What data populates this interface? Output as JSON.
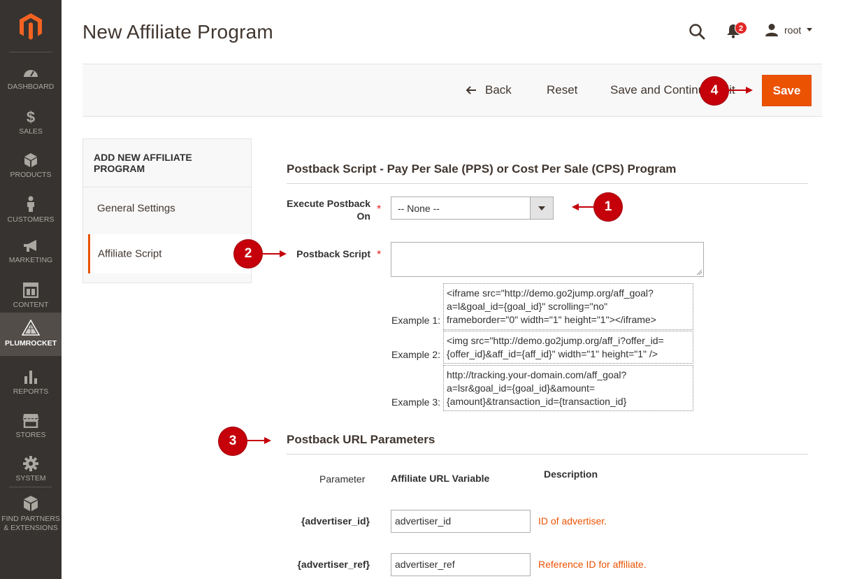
{
  "sidebar": {
    "items": [
      {
        "label": "DASHBOARD",
        "icon": "dashboard-icon"
      },
      {
        "label": "SALES",
        "icon": "dollar-icon"
      },
      {
        "label": "PRODUCTS",
        "icon": "box-icon"
      },
      {
        "label": "CUSTOMERS",
        "icon": "person-icon"
      },
      {
        "label": "MARKETING",
        "icon": "megaphone-icon"
      },
      {
        "label": "CONTENT",
        "icon": "layout-icon"
      },
      {
        "label": "PLUMROCKET",
        "icon": "plumrocket-icon"
      },
      {
        "label": "REPORTS",
        "icon": "bar-chart-icon"
      },
      {
        "label": "STORES",
        "icon": "store-icon"
      },
      {
        "label": "SYSTEM",
        "icon": "gear-icon"
      },
      {
        "label": "FIND PARTNERS & EXTENSIONS",
        "icon": "cube-icon"
      }
    ],
    "active": "PLUMROCKET"
  },
  "header": {
    "title": "New Affiliate Program",
    "notifications_count": "2",
    "user": "root"
  },
  "actions": {
    "back": "Back",
    "reset": "Reset",
    "save_continue": "Save and Continue Edit",
    "save": "Save"
  },
  "tabs": {
    "title": "ADD NEW AFFILIATE PROGRAM",
    "items": [
      "General Settings",
      "Affiliate Script"
    ],
    "active": "Affiliate Script"
  },
  "form": {
    "section1_title": "Postback Script - Pay Per Sale (PPS) or Cost Per Sale (CPS) Program",
    "execute_label_line1": "Execute Postback",
    "execute_label_line2": "On",
    "execute_value": "-- None --",
    "script_label": "Postback Script",
    "script_value": "",
    "examples": [
      {
        "label": "Example 1:",
        "lines": [
          "<iframe src=\"http://demo.go2jump.org/aff_goal?",
          "a=l&goal_id={goal_id}\" scrolling=\"no\"",
          "frameborder=\"0\" width=\"1\" height=\"1\"></iframe>"
        ]
      },
      {
        "label": "Example 2:",
        "lines": [
          "<img src=\"http://demo.go2jump.org/aff_i?offer_id=",
          "{offer_id}&aff_id={aff_id}\" width=\"1\" height=\"1\" />"
        ]
      },
      {
        "label": "Example 3:",
        "lines": [
          "http://tracking.your-domain.com/aff_goal?",
          "a=lsr&goal_id={goal_id}&amount=",
          "{amount}&transaction_id={transaction_id}"
        ]
      }
    ],
    "section2_title": "Postback URL Parameters",
    "columns": {
      "parameter": "Parameter",
      "variable": "Affiliate URL Variable",
      "description": "Description"
    },
    "params": [
      {
        "name": "{advertiser_id}",
        "value": "advertiser_id",
        "description": "ID of advertiser."
      },
      {
        "name": "{advertiser_ref}",
        "value": "advertiser_ref",
        "description": "Reference ID for affiliate."
      }
    ]
  },
  "callouts": [
    "1",
    "2",
    "3",
    "4"
  ],
  "colors": {
    "sidebar_bg": "#373330",
    "accent": "#eb5202",
    "callout": "#c5000b",
    "required": "#e22626"
  }
}
